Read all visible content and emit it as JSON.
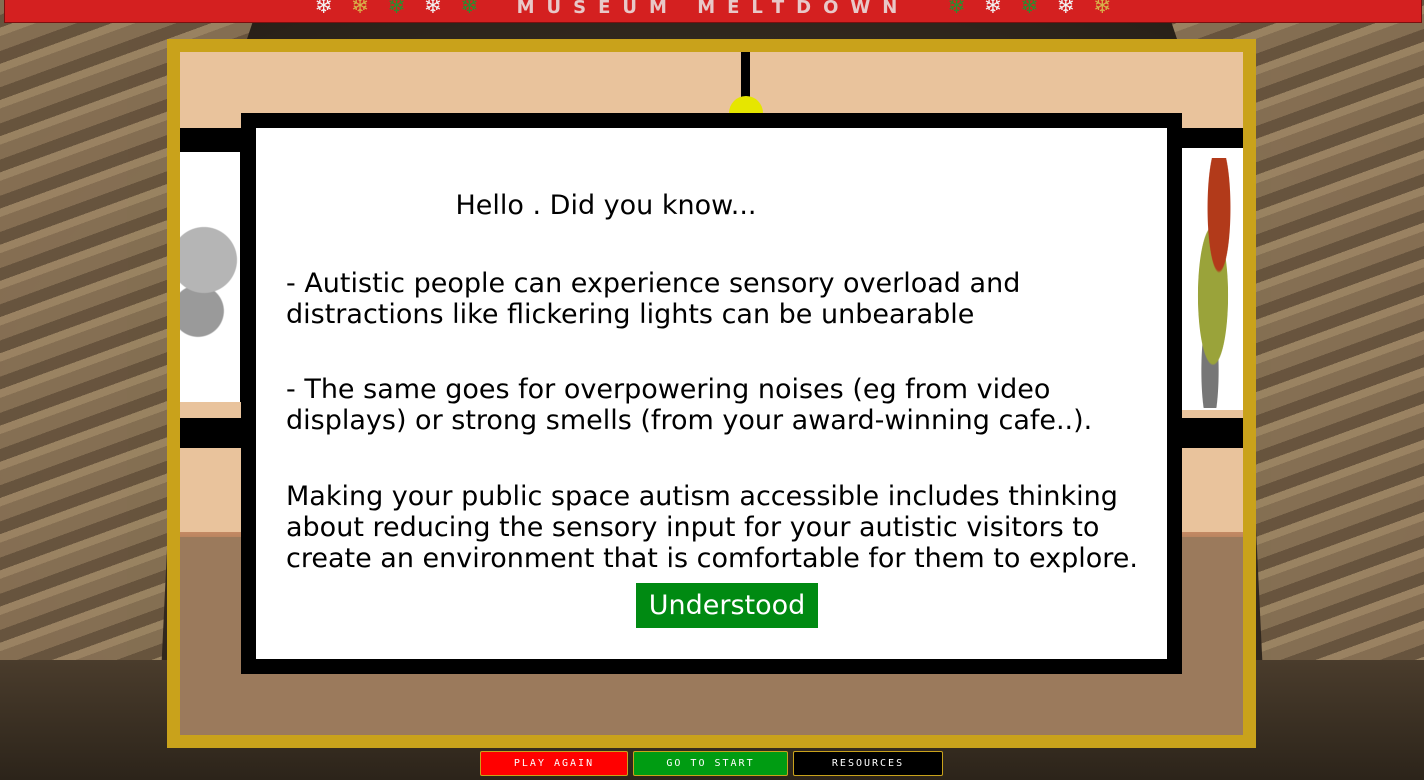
{
  "banner": {
    "title": "MUSEUM MELTDOWN",
    "left_flakes": [
      "w",
      "g",
      "gr",
      "w",
      "gr"
    ],
    "right_flakes": [
      "gr",
      "w",
      "gr",
      "w",
      "g"
    ]
  },
  "modal": {
    "title": "Hello . Did you know...",
    "paragraph1": "- Autistic people can experience sensory overload and\n  distractions like flickering lights can be unbearable",
    "paragraph2": "- The same goes for overpowering noises (eg from video\n  displays) or strong smells (from your award-winning cafe..).",
    "paragraph3": "Making your public space autism accessible includes thinking\nabout reducing the sensory input for your autistic visitors to\ncreate an environment that is comfortable for them to explore.",
    "button_label": "Understood"
  },
  "footer": {
    "play_again": "PLAY AGAIN",
    "go_to_start": "GO TO START",
    "resources": "RESOURCES"
  },
  "colors": {
    "banner": "#d42020",
    "frame": "#c9a21b",
    "understood": "#008a12",
    "play_again": "#ff0000",
    "go_to_start": "#009c12",
    "resources": "#000000"
  }
}
